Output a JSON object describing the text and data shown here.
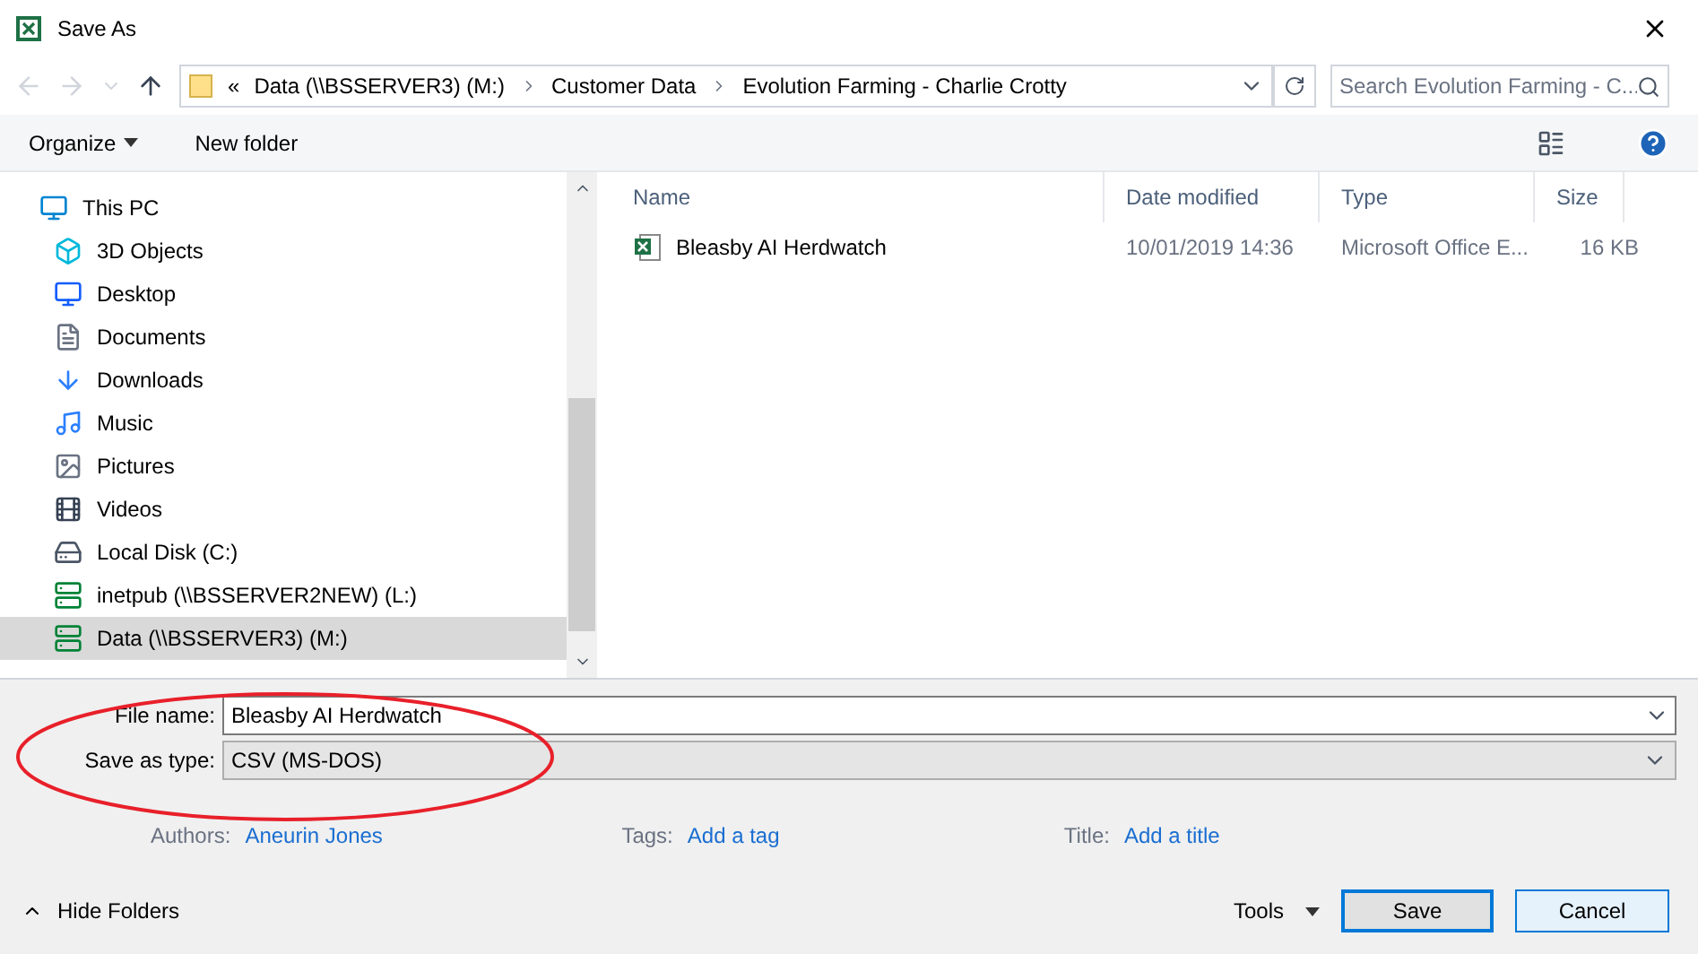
{
  "window": {
    "title": "Save As"
  },
  "address_bar": {
    "prefix": "«",
    "crumbs": [
      "Data (\\\\BSSERVER3) (M:)",
      "Customer Data",
      "Evolution Farming - Charlie Crotty"
    ]
  },
  "search": {
    "placeholder": "Search Evolution Farming - C..."
  },
  "toolbar": {
    "organize": "Organize",
    "new_folder": "New folder"
  },
  "sidebar": {
    "items": [
      {
        "label": "This PC",
        "kind": "pc",
        "selected": false,
        "children": [
          {
            "label": "3D Objects",
            "kind": "cube",
            "selected": false
          },
          {
            "label": "Desktop",
            "kind": "desktop",
            "selected": false
          },
          {
            "label": "Documents",
            "kind": "documents",
            "selected": false
          },
          {
            "label": "Downloads",
            "kind": "downloads",
            "selected": false
          },
          {
            "label": "Music",
            "kind": "music",
            "selected": false
          },
          {
            "label": "Pictures",
            "kind": "pictures",
            "selected": false
          },
          {
            "label": "Videos",
            "kind": "videos",
            "selected": false
          },
          {
            "label": "Local Disk (C:)",
            "kind": "disk",
            "selected": false
          },
          {
            "label": "inetpub (\\\\BSSERVER2NEW) (L:)",
            "kind": "network",
            "selected": false
          },
          {
            "label": "Data (\\\\BSSERVER3) (M:)",
            "kind": "network",
            "selected": true
          }
        ]
      }
    ]
  },
  "table": {
    "columns": [
      "Name",
      "Date modified",
      "Type",
      "Size"
    ],
    "rows": [
      {
        "name": "Bleasby AI Herdwatch",
        "date": "10/01/2019 14:36",
        "type": "Microsoft Office E...",
        "size": "16 KB"
      }
    ]
  },
  "form": {
    "file_name_label": "File name:",
    "file_name": "Bleasby AI Herdwatch",
    "type_label": "Save as type:",
    "type": "CSV (MS-DOS)",
    "authors_label": "Authors:",
    "authors": "Aneurin Jones",
    "tags_label": "Tags:",
    "tags": "Add a tag",
    "title_label": "Title:",
    "title": "Add a title"
  },
  "footer": {
    "hide_folders": "Hide Folders",
    "tools": "Tools",
    "save": "Save",
    "cancel": "Cancel"
  }
}
